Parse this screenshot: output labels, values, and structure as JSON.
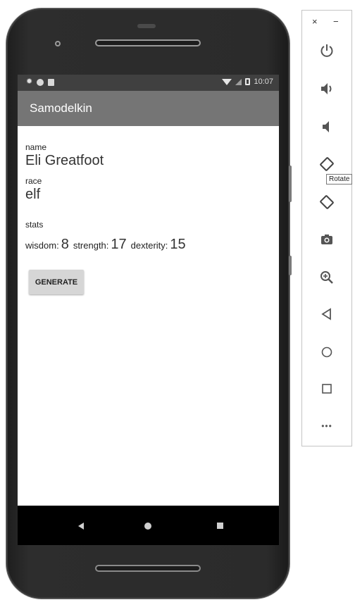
{
  "status_bar": {
    "time": "10:07"
  },
  "app": {
    "title": "Samodelkin"
  },
  "character": {
    "name_label": "name",
    "name_value": "Eli Greatfoot",
    "race_label": "race",
    "race_value": "elf",
    "stats_label": "stats",
    "stats": {
      "wisdom_label": "wisdom:",
      "wisdom_value": "8",
      "strength_label": "strength:",
      "strength_value": "17",
      "dexterity_label": "dexterity:",
      "dexterity_value": "15"
    },
    "generate_button": "GENERATE"
  },
  "emulator_toolbar": {
    "close_glyph": "×",
    "minimize_glyph": "−",
    "tooltip": "Rotate",
    "more_glyph": "•••",
    "icons": [
      "power-icon",
      "volume-up-icon",
      "volume-down-icon",
      "rotate-left-icon",
      "rotate-right-icon",
      "camera-icon",
      "zoom-icon",
      "back-icon",
      "home-icon",
      "overview-icon",
      "more-icon"
    ]
  },
  "colors": {
    "status_bar": "#404040",
    "app_bar": "#757575",
    "button": "#d6d6d6"
  }
}
